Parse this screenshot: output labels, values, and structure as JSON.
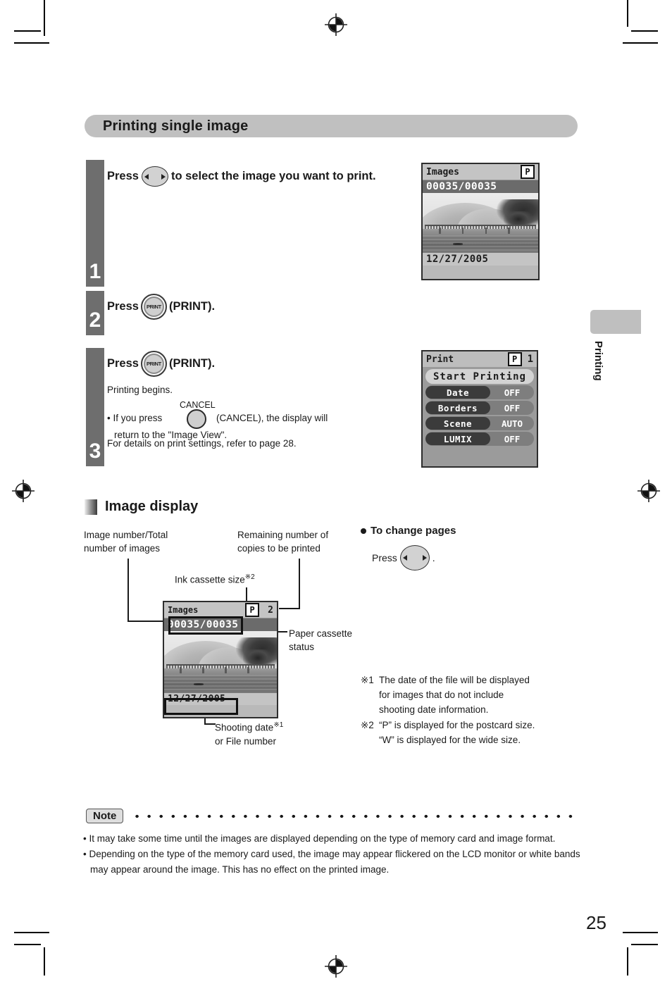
{
  "page": {
    "number": "25",
    "side_tab": "Printing"
  },
  "section": {
    "title": "Printing single image"
  },
  "steps": [
    {
      "number": "1",
      "head_before": "Press",
      "button": "dpad",
      "head_after": "to select the image you want to print.",
      "bullets": []
    },
    {
      "number": "2",
      "head_before": "Press",
      "button": "print",
      "head_after": "(PRINT).",
      "bullets": []
    },
    {
      "number": "3",
      "head_before": "Press",
      "button": "print",
      "head_after": "(PRINT).",
      "bullets": [
        "Printing begins.",
        "If you press          (CANCEL), the display will return to the \"Image View\".",
        "For details on print settings, refer to page 28."
      ],
      "bullet1_a": "• If you press",
      "bullet1_b": "(CANCEL), the display will",
      "bullet1_c": "return to the \"Image View\".",
      "cancel_caption": "CANCEL"
    }
  ],
  "lcd_image_view": {
    "title": "Images",
    "size_badge": "P",
    "counter": "00035/00035",
    "date": "12/27/2005"
  },
  "lcd_print_menu": {
    "title": "Print",
    "size_badge": "P",
    "copies": "1",
    "start_label": "Start Printing",
    "rows": [
      {
        "label": "Date",
        "value": "OFF"
      },
      {
        "label": "Borders",
        "value": "OFF"
      },
      {
        "label": "Scene",
        "value": "AUTO"
      },
      {
        "label": "LUMIX",
        "value": "OFF"
      }
    ]
  },
  "image_display": {
    "heading": "Image display",
    "callouts": {
      "image_number": "Image number/Total\nnumber of images",
      "image_number_l1": "Image number/Total",
      "image_number_l2": "number of images",
      "remaining_l1": "Remaining number of",
      "remaining_l2": "copies to be printed",
      "ink_cassette": "Ink cassette size",
      "ink_cassette_mark": "※2",
      "paper_l1": "Paper cassette",
      "paper_l2": "status",
      "shooting_date": "Shooting date",
      "shooting_date_mark": "※1",
      "shooting_date_l2": "or File number"
    },
    "change_pages": {
      "heading": "To change pages",
      "press_label": "Press",
      "period": "."
    },
    "lcd": {
      "title": "Images",
      "size_badge": "P",
      "copies": "2",
      "counter": "00035/00035",
      "date": "12/27/2005"
    },
    "footnotes": [
      {
        "mark": "※1",
        "lines": [
          "The date of the file will be displayed",
          "for images that do not include",
          "shooting date information."
        ]
      },
      {
        "mark": "※2",
        "lines": [
          "“P” is displayed for the postcard size.",
          "“W” is displayed for the wide size."
        ]
      }
    ]
  },
  "note": {
    "badge": "Note",
    "items": [
      "• It may take some time until the images are displayed depending on the type of memory card and image format.",
      "• Depending on the type of the memory card used, the image may appear flickered on the LCD monitor or white bands may appear around the image. This has no effect on the printed image."
    ]
  }
}
